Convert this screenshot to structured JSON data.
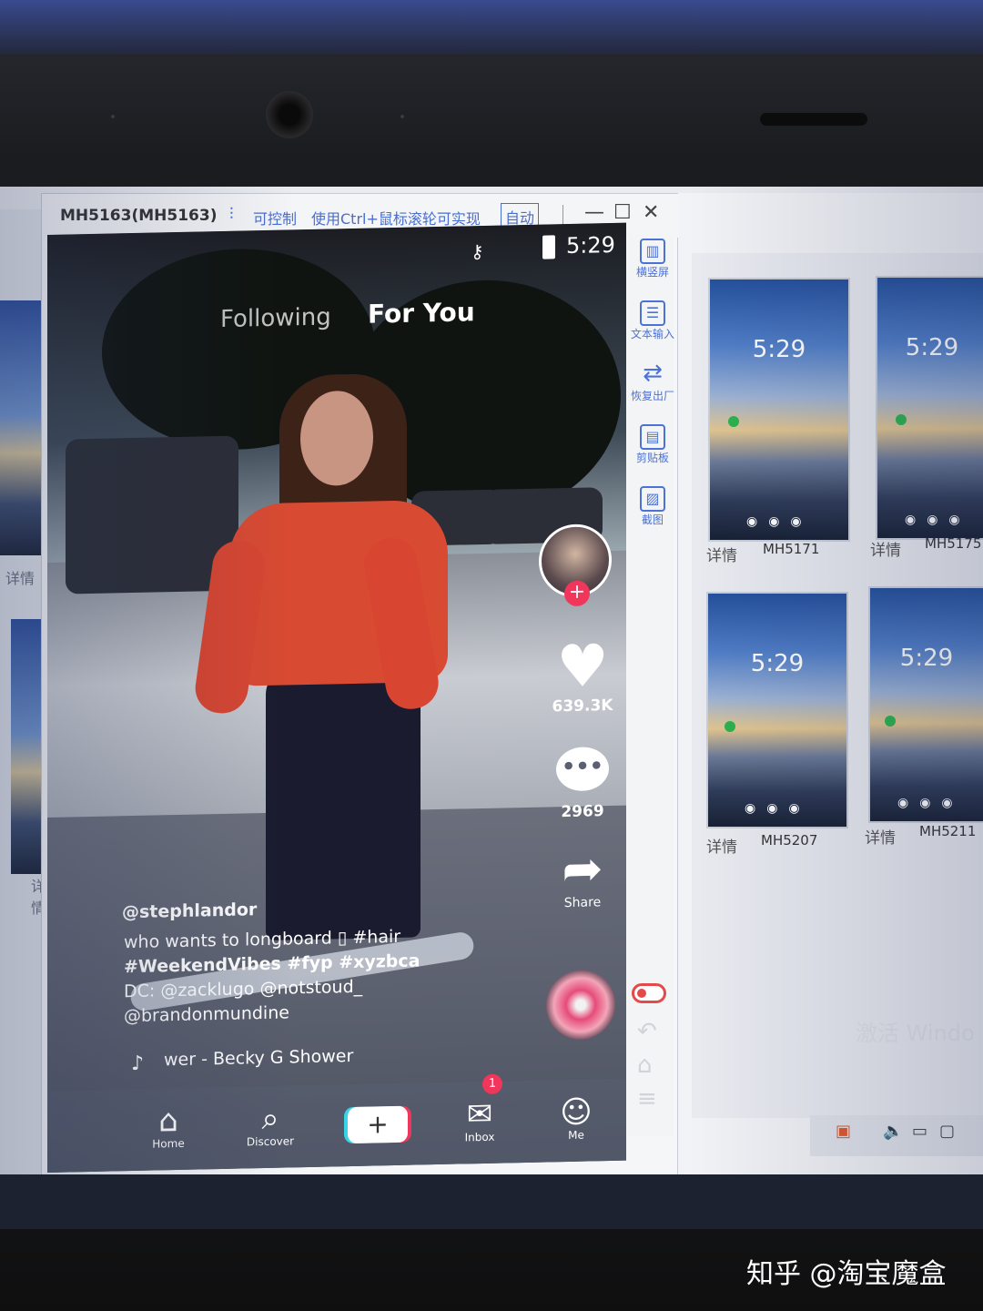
{
  "window": {
    "title": "MH5163(MH5163)",
    "control_label": "可控制",
    "hint": "使用Ctrl+鼠标滚轮可实现",
    "auto_label": "自动",
    "minimize": "—",
    "maximize": "☐",
    "close": "✕"
  },
  "phone": {
    "status_time": "5:29",
    "tabs": {
      "following": "Following",
      "for_you": "For You"
    },
    "likes": "639.3K",
    "comments": "2969",
    "share_label": "Share",
    "caption": {
      "username": "@stephlandor",
      "line1": "who wants to longboard ▯ #hair",
      "line2": "#WeekendVibes #fyp #xyzbca",
      "line3": "DC: @zacklugo @notstoud_",
      "line4": "@brandonmundine"
    },
    "music": "wer - Becky G   Shower",
    "nav": {
      "home": "Home",
      "discover": "Discover",
      "create": "+",
      "inbox": "Inbox",
      "me": "Me",
      "inbox_badge": "1"
    }
  },
  "toolbar": {
    "items": [
      {
        "icon": "rotate-screen-icon",
        "label": "横竖屏"
      },
      {
        "icon": "text-input-icon",
        "label": "文本输入"
      },
      {
        "icon": "factory-reset-icon",
        "label": "恢复出厂"
      },
      {
        "icon": "clipboard-icon",
        "label": "剪贴板"
      },
      {
        "icon": "screenshot-icon",
        "label": "截图"
      }
    ]
  },
  "devices": [
    {
      "time": "5:29",
      "detail": "详情",
      "name": "MH5171"
    },
    {
      "time": "5:29",
      "detail": "详情",
      "name": "MH5175"
    },
    {
      "time": "5:29",
      "detail": "详情",
      "name": "MH5207"
    },
    {
      "time": "5:29",
      "detail": "详情",
      "name": "MH5211"
    }
  ],
  "left_labels": [
    "详情",
    "详情"
  ],
  "activate_windows_text": "激活 Windo",
  "watermark": "知乎 @淘宝魔盒",
  "colors": {
    "accent": "#4d72d6",
    "tiktok_red": "#f0365b",
    "tiktok_cyan": "#35d4e6"
  }
}
